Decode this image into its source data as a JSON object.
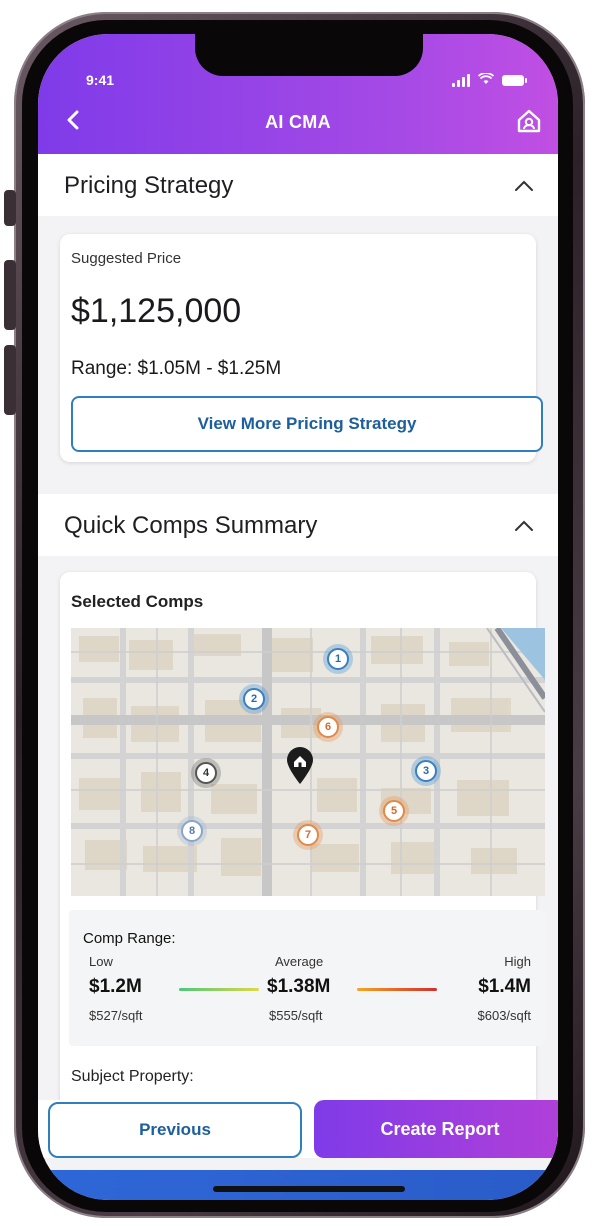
{
  "status_bar": {
    "time": "9:41"
  },
  "header": {
    "title": "AI CMA"
  },
  "pricing_strategy": {
    "title": "Pricing Strategy",
    "suggested_label": "Suggested Price",
    "price": "$1,125,000",
    "range": "Range: $1.05M - $1.25M",
    "button_label": "View More Pricing Strategy"
  },
  "quick_comps": {
    "title": "Quick Comps Summary",
    "selected_label": "Selected Comps",
    "map_pins": [
      {
        "num": "1",
        "style": "blue"
      },
      {
        "num": "2",
        "style": "blue"
      },
      {
        "num": "3",
        "style": "blue"
      },
      {
        "num": "4",
        "style": "gray"
      },
      {
        "num": "5",
        "style": "orange"
      },
      {
        "num": "6",
        "style": "orange"
      },
      {
        "num": "7",
        "style": "orange"
      },
      {
        "num": "8",
        "style": "lightblue"
      }
    ],
    "comp_range": {
      "title": "Comp Range:",
      "low_label": "Low",
      "avg_label": "Average",
      "high_label": "High",
      "low_value": "$1.2M",
      "avg_value": "$1.38M",
      "high_value": "$1.4M",
      "low_sqft": "$527/sqft",
      "avg_sqft": "$555/sqft",
      "high_sqft": "$603/sqft"
    },
    "subject_label": "Subject Property:"
  },
  "footer": {
    "previous_label": "Previous",
    "create_label": "Create Report"
  },
  "colors": {
    "accent": "#8a3ee8",
    "link": "#1d5e9c",
    "border": "#2f7fbf"
  }
}
